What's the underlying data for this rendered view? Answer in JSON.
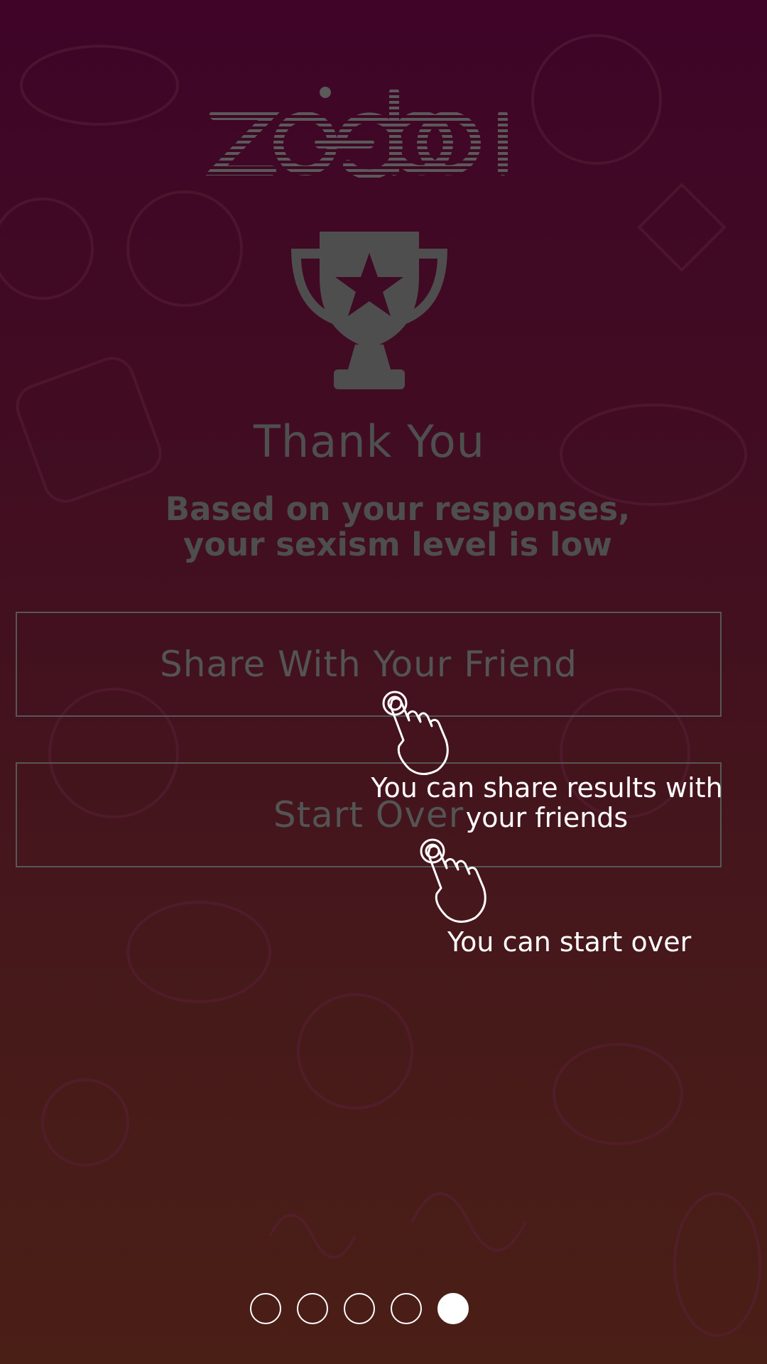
{
  "app": {
    "logo_text": "zoeba"
  },
  "result": {
    "title": "Thank You",
    "message": "Based on your responses,\nyour sexism level is low"
  },
  "actions": {
    "share_label": "Share With Your Friend",
    "start_over_label": "Start Over"
  },
  "coach_marks": {
    "share_tip": "You can share results with\nyour friends",
    "start_over_tip": "You can start over"
  },
  "pager": {
    "total": 5,
    "active_index": 4
  },
  "colors": {
    "background_top": "#3f0428",
    "background_bottom": "#4a1f16",
    "dimmed_text": "#4f4f4f",
    "tip_text": "#ffffff"
  },
  "icons": {
    "trophy": "trophy-icon",
    "tap_hand": "tap-hand-icon"
  }
}
